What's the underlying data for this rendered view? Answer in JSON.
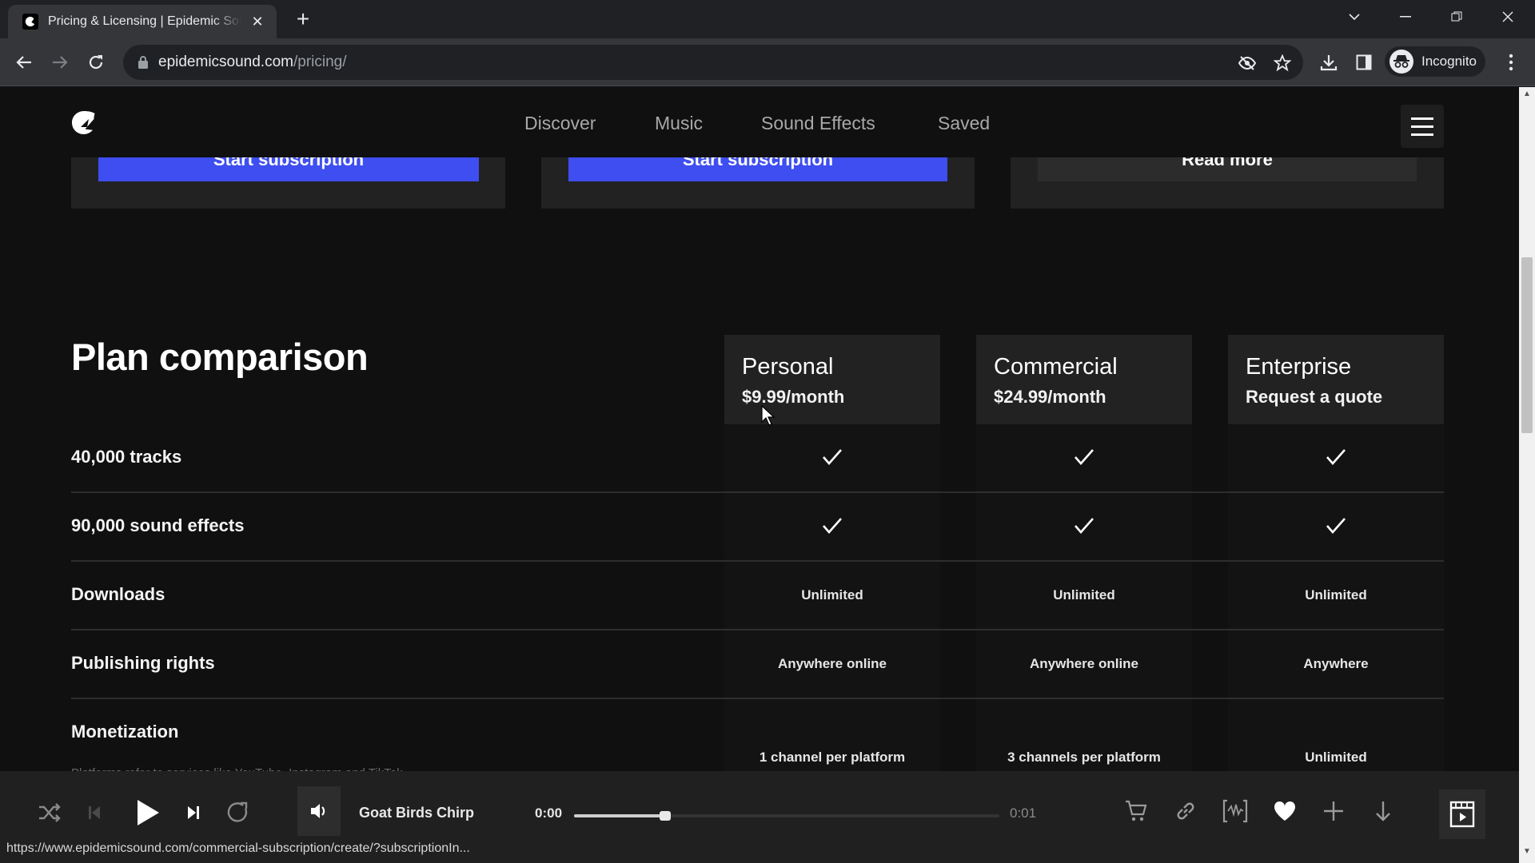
{
  "browser": {
    "tab_title": "Pricing & Licensing | Epidemic Sound",
    "url_host": "epidemicsound.com",
    "url_path": "/pricing/",
    "profile_label": "Incognito",
    "status_url": "https://www.epidemicsound.com/commercial-subscription/create/?subscriptionIn..."
  },
  "site_nav": {
    "links": [
      "Discover",
      "Music",
      "Sound Effects",
      "Saved"
    ]
  },
  "plan_cards": [
    {
      "cta": "Start subscription",
      "style": "primary"
    },
    {
      "cta": "Start subscription",
      "style": "primary"
    },
    {
      "cta": "Read more",
      "style": "secondary"
    }
  ],
  "comparison": {
    "title": "Plan comparison",
    "plans": [
      {
        "name": "Personal",
        "price": "$9.99/month"
      },
      {
        "name": "Commercial",
        "price": "$24.99/month"
      },
      {
        "name": "Enterprise",
        "price": "Request a quote"
      }
    ],
    "rows": [
      {
        "label": "40,000 tracks",
        "values": [
          "check",
          "check",
          "check"
        ]
      },
      {
        "label": "90,000 sound effects",
        "values": [
          "check",
          "check",
          "check"
        ]
      },
      {
        "label": "Downloads",
        "values": [
          "Unlimited",
          "Unlimited",
          "Unlimited"
        ]
      },
      {
        "label": "Publishing rights",
        "values": [
          "Anywhere online",
          "Anywhere online",
          "Anywhere"
        ]
      },
      {
        "label": "Monetization",
        "sublabel": "Platforms refer to services like YouTube, Instagram and TikTok",
        "values": [
          "1 channel per platform",
          "3 channels per platform",
          "Unlimited"
        ]
      }
    ]
  },
  "player": {
    "track_title": "Goat Birds Chirp",
    "current_time": "0:00",
    "duration": "0:01",
    "progress_fraction": 0.0,
    "buffered_fraction": 0.22,
    "icons": [
      "shuffle-icon",
      "previous-icon",
      "play-icon",
      "next-icon",
      "repeat-icon",
      "volume-icon",
      "cart-icon",
      "link-icon",
      "stems-icon",
      "heart-icon",
      "add-icon",
      "download-icon",
      "video-icon"
    ]
  },
  "colors": {
    "accent": "#3e4ef0",
    "background": "#101011",
    "card": "#222223"
  }
}
